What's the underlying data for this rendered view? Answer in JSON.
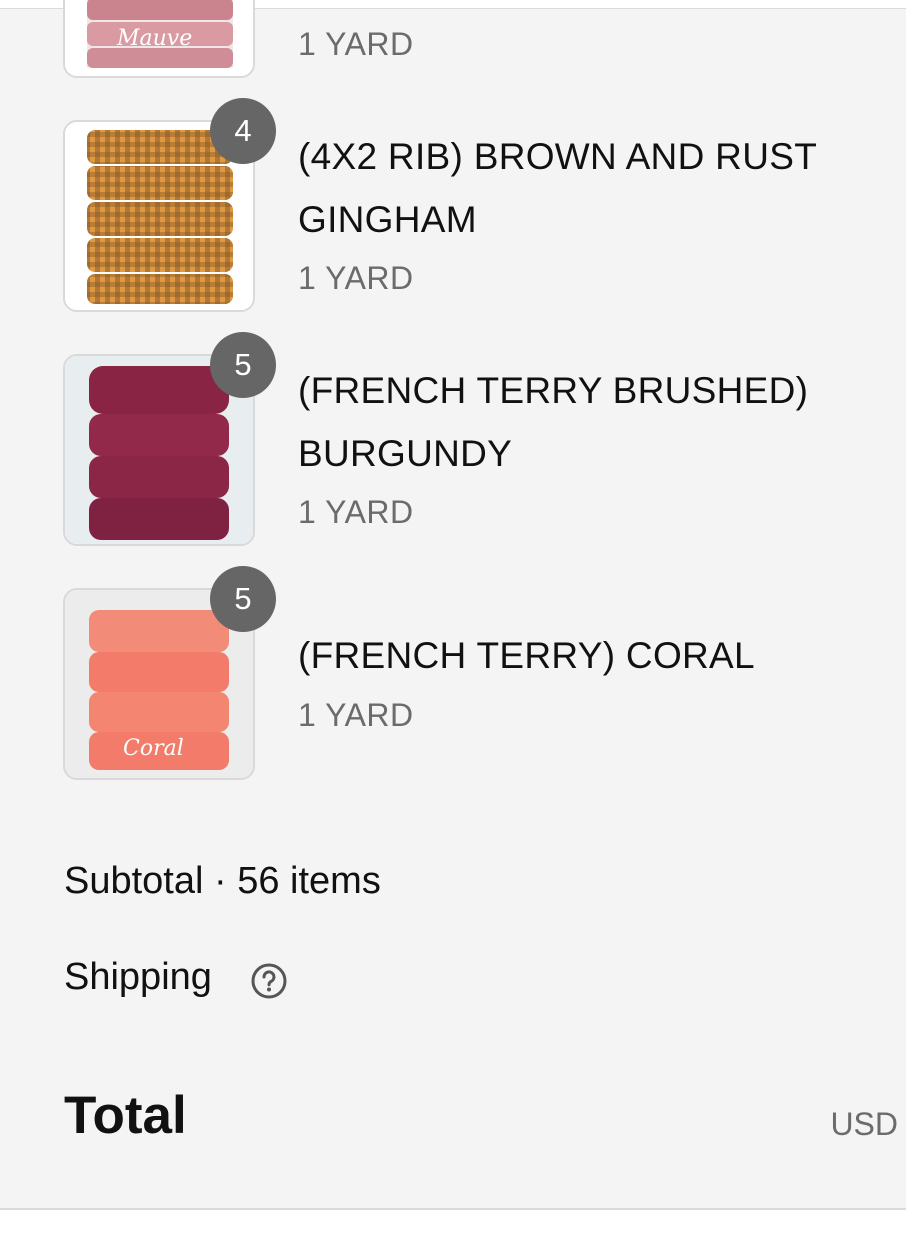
{
  "items": [
    {
      "title": "",
      "variant": "1 YARD",
      "image_label": "Mauve",
      "badge": "",
      "color": "#d99aa2"
    },
    {
      "title": "(4X2 RIB) BROWN AND RUST GINGHAM",
      "variant": "1 YARD",
      "badge": "4",
      "color": "#d98b35"
    },
    {
      "title": "(FRENCH TERRY BRUSHED) BURGUNDY",
      "variant": "1 YARD",
      "badge": "5",
      "color": "#93294a"
    },
    {
      "title": "(FRENCH TERRY) CORAL",
      "variant": "1 YARD",
      "image_label": "Coral",
      "badge": "5",
      "color": "#f27b6a"
    }
  ],
  "summary": {
    "subtotal_label": "Subtotal · 56 items",
    "shipping_label": "Shipping",
    "shipping_help_icon": "question-circle-icon",
    "total_label": "Total",
    "currency": "USD"
  }
}
